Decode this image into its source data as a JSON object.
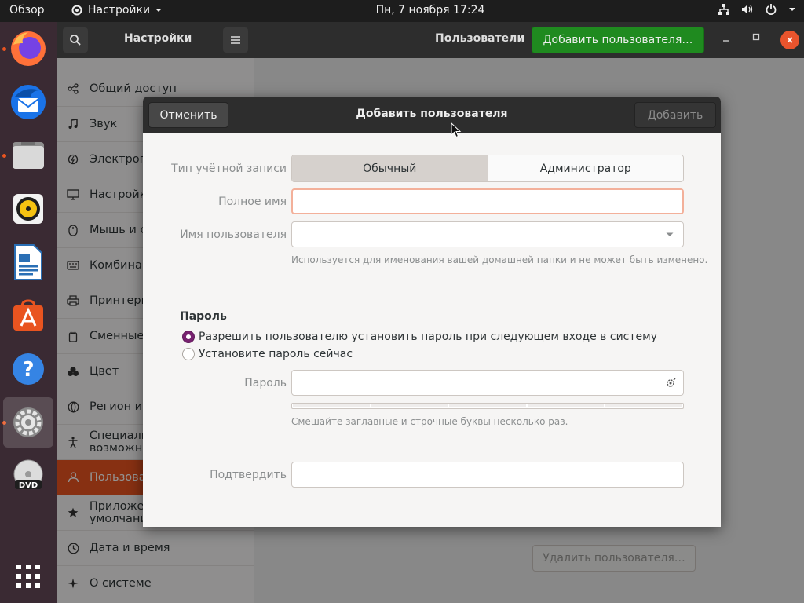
{
  "topbar": {
    "activities": "Обзор",
    "app_menu": "Настройки",
    "clock": "Пн, 7 ноября  17:24"
  },
  "dock": {
    "items": [
      "firefox-icon",
      "thunderbird-icon",
      "files-icon",
      "rhythmbox-icon",
      "libreoffice-writer-icon",
      "software-icon",
      "help-icon",
      "settings-icon",
      "dvd-icon",
      "show-apps-icon"
    ]
  },
  "settings": {
    "left_title": "Настройки",
    "right_title": "Пользователи",
    "add_user_button": "Добавить пользователя…",
    "sidebar": [
      {
        "label": "Общий доступ",
        "icon": "share-icon"
      },
      {
        "label": "Звук",
        "icon": "music-note-icon"
      },
      {
        "label": "Электропитание",
        "icon": "power-icon"
      },
      {
        "label": "Настройки экрана",
        "icon": "display-icon"
      },
      {
        "label": "Мышь и сенсорная панель",
        "icon": "mouse-icon"
      },
      {
        "label": "Комбинации клавиш",
        "icon": "keyboard-icon"
      },
      {
        "label": "Принтеры",
        "icon": "printer-icon"
      },
      {
        "label": "Сменные носители",
        "icon": "removable-media-icon"
      },
      {
        "label": "Цвет",
        "icon": "color-icon"
      },
      {
        "label": "Регион и язык",
        "icon": "globe-icon"
      },
      {
        "label": "Специальные возможности",
        "icon": "accessibility-icon"
      },
      {
        "label": "Пользователи",
        "icon": "users-icon"
      },
      {
        "label": "Приложения по умолчанию",
        "icon": "star-icon"
      },
      {
        "label": "Дата и время",
        "icon": "clock-icon"
      },
      {
        "label": "О системе",
        "icon": "about-icon"
      }
    ],
    "delete_user_button": "Удалить пользователя…"
  },
  "dialog": {
    "title": "Добавить пользователя",
    "cancel": "Отменить",
    "add": "Добавить",
    "account_type_label": "Тип учётной записи",
    "account_type_options": [
      "Обычный",
      "Администратор"
    ],
    "account_type_selected": "Обычный",
    "full_name_label": "Полное имя",
    "full_name_value": "",
    "username_label": "Имя пользователя",
    "username_value": "",
    "username_hint": "Используется для именования вашей домашней папки и не может быть изменено.",
    "password_section": "Пароль",
    "radio_allow": "Разрешить пользователю установить пароль при следующем входе в систему",
    "radio_set_now": "Установите пароль сейчас",
    "password_label": "Пароль",
    "password_value": "",
    "password_hint": "Смешайте заглавные и строчные буквы несколько раз.",
    "confirm_label": "Подтвердить",
    "confirm_value": ""
  },
  "colors": {
    "accent": "#e95420",
    "add_green": "#1f8a1f",
    "radio_purple": "#77216f"
  }
}
